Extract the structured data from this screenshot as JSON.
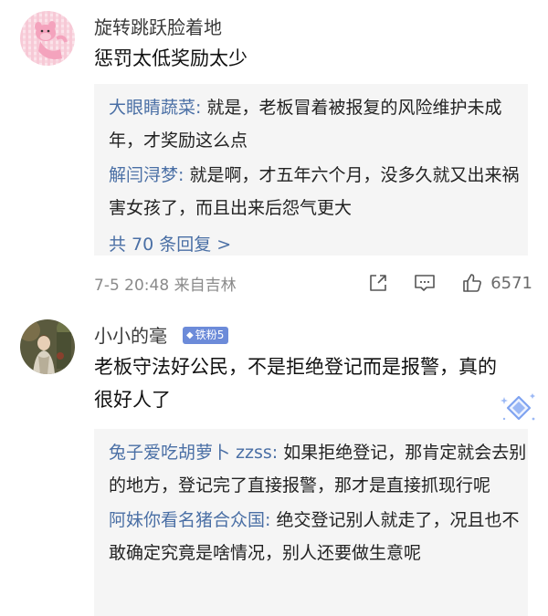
{
  "comments": [
    {
      "username": "旋转跳跃脸着地",
      "avatar": "pink-panther-avatar",
      "text": "惩罚太低奖励太少",
      "replies": [
        {
          "user": "大眼睛蔬菜:",
          "text": " 就是，老板冒着被报复的风险维护未成年，才奖励这么点"
        },
        {
          "user": "解闫浔梦:",
          "text": " 就是啊，才五年六个月，没多久就又出来祸害女孩了，而且出来后怨气更大"
        }
      ],
      "more_replies": "共 70 条回复 >",
      "meta": {
        "time": "7-5 20:48  来自吉林",
        "like_count": "6571"
      }
    },
    {
      "username": "小小的毫",
      "badge": "铁粉5",
      "avatar": "painting-avatar",
      "text": "老板守法好公民，不是拒绝登记而是报警，真的很好人了",
      "replies": [
        {
          "user": "兔子爱吃胡萝卜 zzss:",
          "text": " 如果拒绝登记，那肯定就会去别的地方，登记完了直接报警，那才是直接抓现行呢"
        },
        {
          "user": "阿妹你看名猪合众国:",
          "text": " 绝交登记别人就走了，况且也不敢确定究竟是啥情况，别人还要做生意呢"
        }
      ]
    }
  ],
  "colors": {
    "reply_user": "#4a6fa5",
    "reply_bg": "#f5f5f5",
    "badge_bg": "#6c8bd9",
    "meta_gray": "#8a8a8a"
  }
}
